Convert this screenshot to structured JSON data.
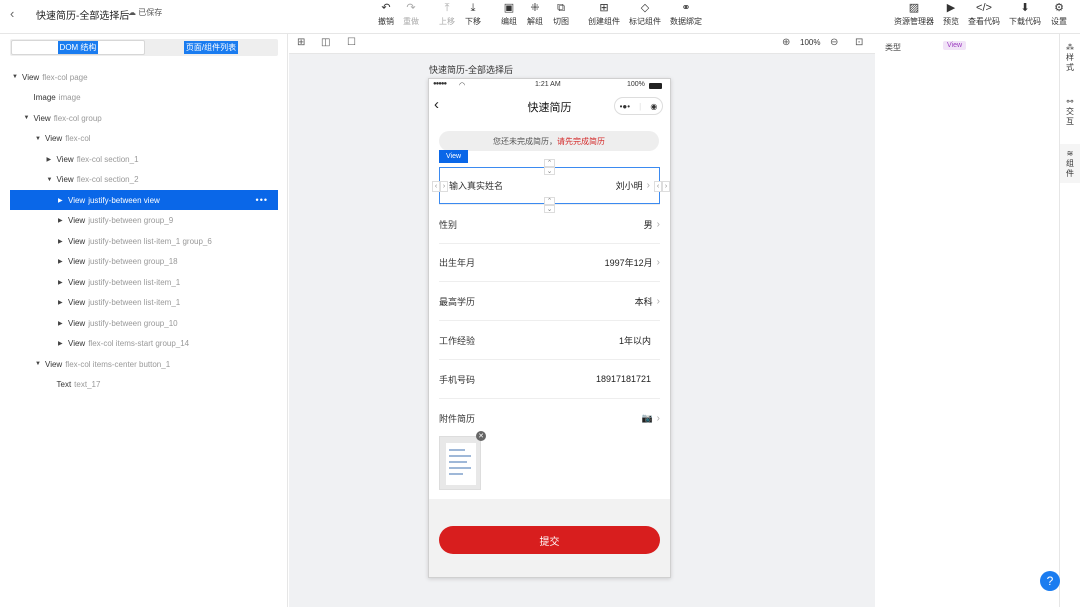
{
  "topbar": {
    "back_icon": "chevron-left-icon",
    "title": "快速简历-全部选择后",
    "saved": "已保存",
    "tools_center": [
      {
        "icon": "↶",
        "label": "撤销",
        "disabled": false
      },
      {
        "icon": "↷",
        "label": "重做",
        "disabled": true
      },
      {
        "icon": "⤒",
        "label": "上移",
        "disabled": true
      },
      {
        "icon": "⤓",
        "label": "下移",
        "disabled": false
      },
      {
        "icon": "▣",
        "label": "编组",
        "disabled": false
      },
      {
        "icon": "⁜",
        "label": "解组",
        "disabled": false
      },
      {
        "icon": "⧉",
        "label": "切图",
        "disabled": false
      },
      {
        "icon": "⊞",
        "label": "创建组件",
        "disabled": false
      },
      {
        "icon": "◇",
        "label": "标记组件",
        "disabled": false
      },
      {
        "icon": "⚭",
        "label": "数据绑定",
        "disabled": false
      }
    ],
    "tools_right": [
      {
        "icon": "▨",
        "label": "资源管理器"
      },
      {
        "icon": "▶",
        "label": "预览"
      },
      {
        "icon": "</>",
        "label": "查看代码"
      },
      {
        "icon": "⬇",
        "label": "下载代码"
      },
      {
        "icon": "⚙",
        "label": "设置"
      }
    ]
  },
  "left_panel": {
    "tabs": [
      "DOM 结构",
      "页面/组件列表"
    ],
    "tree": [
      {
        "name": "View",
        "cls": "flex-col page",
        "indent": 0,
        "twisty": "▼",
        "selected": false
      },
      {
        "name": "Image",
        "cls": "image",
        "indent": 1,
        "twisty": "",
        "selected": false
      },
      {
        "name": "View",
        "cls": "flex-col group",
        "indent": 1,
        "twisty": "▼",
        "selected": false
      },
      {
        "name": "View",
        "cls": "flex-col",
        "indent": 2,
        "twisty": "▼",
        "selected": false
      },
      {
        "name": "View",
        "cls": "flex-col section_1",
        "indent": 3,
        "twisty": "▶",
        "selected": false
      },
      {
        "name": "View",
        "cls": "flex-col section_2",
        "indent": 3,
        "twisty": "▼",
        "selected": false
      },
      {
        "name": "View",
        "cls": "justify-between view",
        "indent": 4,
        "twisty": "▶",
        "selected": true
      },
      {
        "name": "View",
        "cls": "justify-between group_9",
        "indent": 4,
        "twisty": "▶",
        "selected": false
      },
      {
        "name": "View",
        "cls": "justify-between list-item_1 group_6",
        "indent": 4,
        "twisty": "▶",
        "selected": false
      },
      {
        "name": "View",
        "cls": "justify-between group_18",
        "indent": 4,
        "twisty": "▶",
        "selected": false
      },
      {
        "name": "View",
        "cls": "justify-between list-item_1",
        "indent": 4,
        "twisty": "▶",
        "selected": false
      },
      {
        "name": "View",
        "cls": "justify-between list-item_1",
        "indent": 4,
        "twisty": "▶",
        "selected": false
      },
      {
        "name": "View",
        "cls": "justify-between group_10",
        "indent": 4,
        "twisty": "▶",
        "selected": false
      },
      {
        "name": "View",
        "cls": "flex-col items-start group_14",
        "indent": 4,
        "twisty": "▶",
        "selected": false
      },
      {
        "name": "View",
        "cls": "flex-col items-center button_1",
        "indent": 2,
        "twisty": "▼",
        "selected": false
      },
      {
        "name": "Text",
        "cls": "text_17",
        "indent": 3,
        "twisty": "",
        "selected": false
      }
    ],
    "more": "•••"
  },
  "canvas": {
    "zoom": "100%",
    "phone_label": "快速简历-全部选择后",
    "status": {
      "signal": "●●●●●",
      "wifi": "◠",
      "time": "1:21 AM",
      "battery": "100%"
    },
    "nav_title": "快速简历",
    "capsule": [
      "•●•",
      "◉"
    ],
    "notice": "您还未完成简历，",
    "notice_link": "请先完成简历",
    "selection_badge": "View",
    "rows": [
      {
        "label": "输入真实姓名",
        "value": "刘小明",
        "arrow": "›"
      },
      {
        "label": "性别",
        "value": "男",
        "arrow": "›"
      },
      {
        "label": "出生年月",
        "value": "1997年12月",
        "arrow": "›"
      },
      {
        "label": "最高学历",
        "value": "本科",
        "arrow": "›"
      },
      {
        "label": "工作经验",
        "value": "1年以内",
        "arrow": ""
      },
      {
        "label": "手机号码",
        "value": "18917181721",
        "arrow": ""
      },
      {
        "label": "附件简历",
        "value": "📷",
        "arrow": "›"
      }
    ],
    "submit": "提交"
  },
  "right_panel": {
    "prop_label": "类型",
    "prop_value": "View",
    "side_tabs": [
      {
        "icon": "⁂",
        "label": "样式"
      },
      {
        "icon": "⚯",
        "label": "交互"
      },
      {
        "icon": "≋",
        "label": "组件"
      }
    ],
    "help": "?"
  }
}
